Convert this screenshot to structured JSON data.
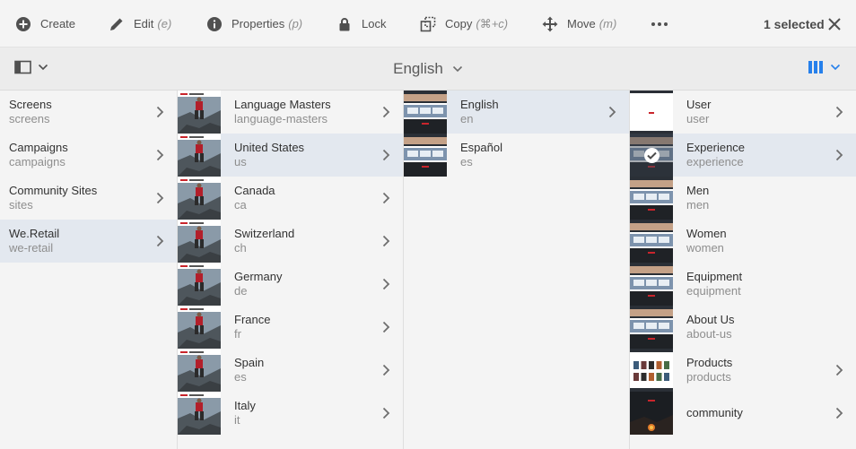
{
  "actionbar": {
    "actions": [
      {
        "id": "create",
        "label": "Create",
        "shortcut": "",
        "icon": "plus-circle-icon"
      },
      {
        "id": "edit",
        "label": "Edit",
        "shortcut": "(e)",
        "icon": "pencil-icon"
      },
      {
        "id": "properties",
        "label": "Properties",
        "shortcut": "(p)",
        "icon": "info-icon"
      },
      {
        "id": "lock",
        "label": "Lock",
        "shortcut": "",
        "icon": "lock-icon"
      },
      {
        "id": "copy",
        "label": "Copy",
        "shortcut": "(⌘+c)",
        "icon": "copy-icon"
      },
      {
        "id": "move",
        "label": "Move",
        "shortcut": "(m)",
        "icon": "move-icon"
      }
    ],
    "more_icon": "more-icon",
    "selection_text": "1 selected",
    "close_icon": "close-icon"
  },
  "titlebar": {
    "title": "English",
    "rail_icon": "rail-toggle-icon",
    "view_icon": "column-view-icon",
    "accent": "#2680eb"
  },
  "columns": [
    {
      "items": [
        {
          "name": "Screens",
          "sub": "screens",
          "has_children": true,
          "selected": false
        },
        {
          "name": "Campaigns",
          "sub": "campaigns",
          "has_children": true,
          "selected": false
        },
        {
          "name": "Community Sites",
          "sub": "sites",
          "has_children": true,
          "selected": false
        },
        {
          "name": "We.Retail",
          "sub": "we-retail",
          "has_children": true,
          "selected": true
        }
      ]
    },
    {
      "items": [
        {
          "name": "Language Masters",
          "sub": "language-masters",
          "has_children": true,
          "selected": false,
          "thumb": "hiker"
        },
        {
          "name": "United States",
          "sub": "us",
          "has_children": true,
          "selected": true,
          "thumb": "hiker"
        },
        {
          "name": "Canada",
          "sub": "ca",
          "has_children": true,
          "selected": false,
          "thumb": "hiker"
        },
        {
          "name": "Switzerland",
          "sub": "ch",
          "has_children": true,
          "selected": false,
          "thumb": "hiker"
        },
        {
          "name": "Germany",
          "sub": "de",
          "has_children": true,
          "selected": false,
          "thumb": "hiker"
        },
        {
          "name": "France",
          "sub": "fr",
          "has_children": true,
          "selected": false,
          "thumb": "hiker"
        },
        {
          "name": "Spain",
          "sub": "es",
          "has_children": true,
          "selected": false,
          "thumb": "hiker"
        },
        {
          "name": "Italy",
          "sub": "it",
          "has_children": true,
          "selected": false,
          "thumb": "hiker"
        }
      ]
    },
    {
      "items": [
        {
          "name": "English",
          "sub": "en",
          "has_children": true,
          "selected": true,
          "thumb": "site"
        },
        {
          "name": "Español",
          "sub": "es",
          "has_children": false,
          "selected": false,
          "thumb": "site"
        }
      ]
    },
    {
      "items": [
        {
          "name": "User",
          "sub": "user",
          "has_children": true,
          "selected": false,
          "thumb": "white"
        },
        {
          "name": "Experience",
          "sub": "experience",
          "has_children": true,
          "selected": true,
          "checked": true,
          "thumb": "site"
        },
        {
          "name": "Men",
          "sub": "men",
          "has_children": false,
          "selected": false,
          "thumb": "site"
        },
        {
          "name": "Women",
          "sub": "women",
          "has_children": false,
          "selected": false,
          "thumb": "site"
        },
        {
          "name": "Equipment",
          "sub": "equipment",
          "has_children": false,
          "selected": false,
          "thumb": "site"
        },
        {
          "name": "About Us",
          "sub": "about-us",
          "has_children": false,
          "selected": false,
          "thumb": "site"
        },
        {
          "name": "Products",
          "sub": "products",
          "has_children": true,
          "selected": false,
          "thumb": "products"
        },
        {
          "name": "community",
          "sub": "",
          "has_children": true,
          "selected": false,
          "thumb": "night"
        }
      ]
    }
  ]
}
